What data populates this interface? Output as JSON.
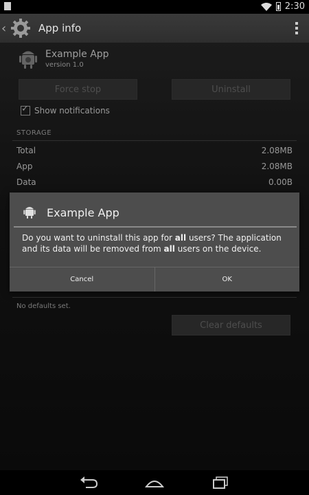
{
  "status_bar": {
    "time": "2:30"
  },
  "action_bar": {
    "title": "App info"
  },
  "app": {
    "name": "Example App",
    "version": "version 1.0"
  },
  "buttons": {
    "force_stop": "Force stop",
    "uninstall": "Uninstall",
    "clear_defaults": "Clear defaults"
  },
  "notifications": {
    "label": "Show notifications",
    "checked": true
  },
  "storage": {
    "header": "STORAGE",
    "rows": [
      {
        "label": "Total",
        "value": "2.08MB"
      },
      {
        "label": "App",
        "value": "2.08MB"
      },
      {
        "label": "Data",
        "value": "0.00B"
      }
    ]
  },
  "defaults": {
    "text": "No defaults set."
  },
  "dialog": {
    "title": "Example App",
    "msg_1": "Do you want to uninstall this app for ",
    "msg_bold_1": "all",
    "msg_2": " users? The application and its data will be removed from ",
    "msg_bold_2": "all",
    "msg_3": " users on the device.",
    "cancel": "Cancel",
    "ok": "OK"
  },
  "icons": {
    "wifi": "wifi-icon",
    "battery": "battery-icon",
    "settings": "gear-icon",
    "overflow": "overflow-menu-icon",
    "app": "android-icon",
    "back": "back-icon",
    "home": "home-icon",
    "recents": "recents-icon"
  }
}
